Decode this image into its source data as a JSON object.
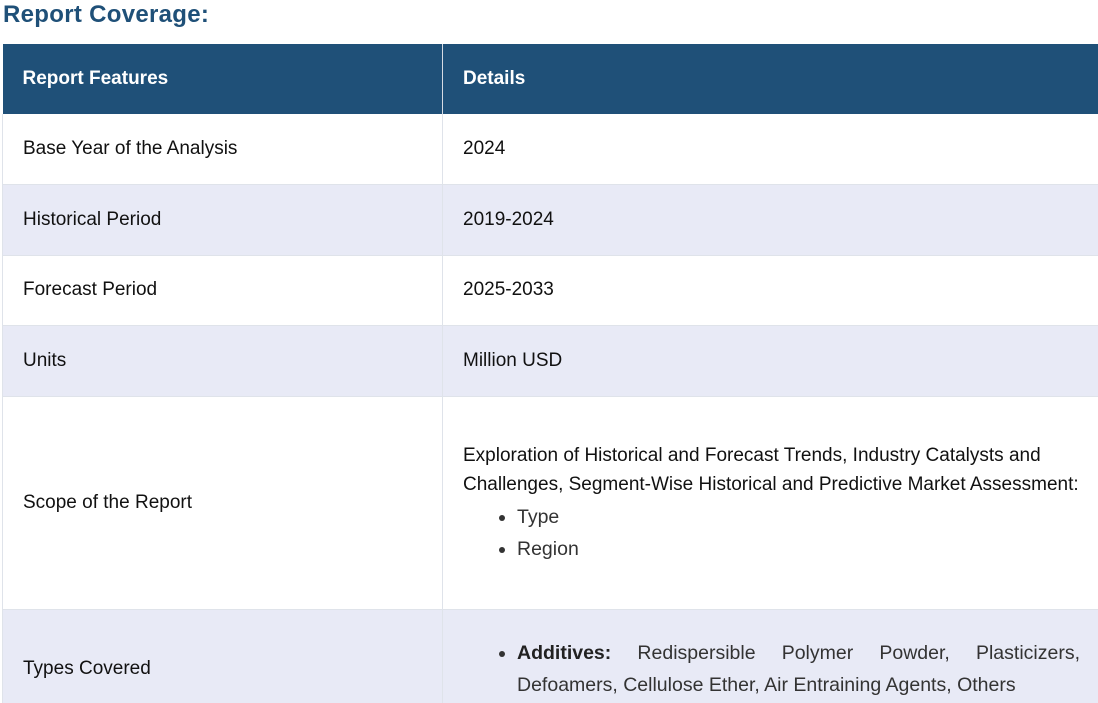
{
  "heading": "Report Coverage:",
  "table": {
    "headers": [
      "Report Features",
      "Details"
    ],
    "rows": [
      {
        "feature": "Base Year of the Analysis",
        "detail": "2024"
      },
      {
        "feature": "Historical Period",
        "detail": "2019-2024"
      },
      {
        "feature": "Forecast Period",
        "detail": "2025-2033"
      },
      {
        "feature": "Units",
        "detail": "Million USD"
      }
    ],
    "scope": {
      "feature": "Scope of the Report",
      "intro": "Exploration of Historical and Forecast Trends, Industry Catalysts and Challenges, Segment-Wise Historical and Predictive Market Assessment:",
      "items": [
        "Type",
        "Region"
      ]
    },
    "types": {
      "feature": "Types Covered",
      "items": [
        {
          "label": "Additives:",
          "text": "Redispersible Polymer Powder, Plasticizers, Defoamers, Cellulose Ether, Air Entraining Agents, Others"
        }
      ]
    }
  },
  "colors": {
    "header_bg": "#1f5078",
    "alt_row_bg": "#e8eaf6",
    "heading_color": "#1f5078"
  }
}
